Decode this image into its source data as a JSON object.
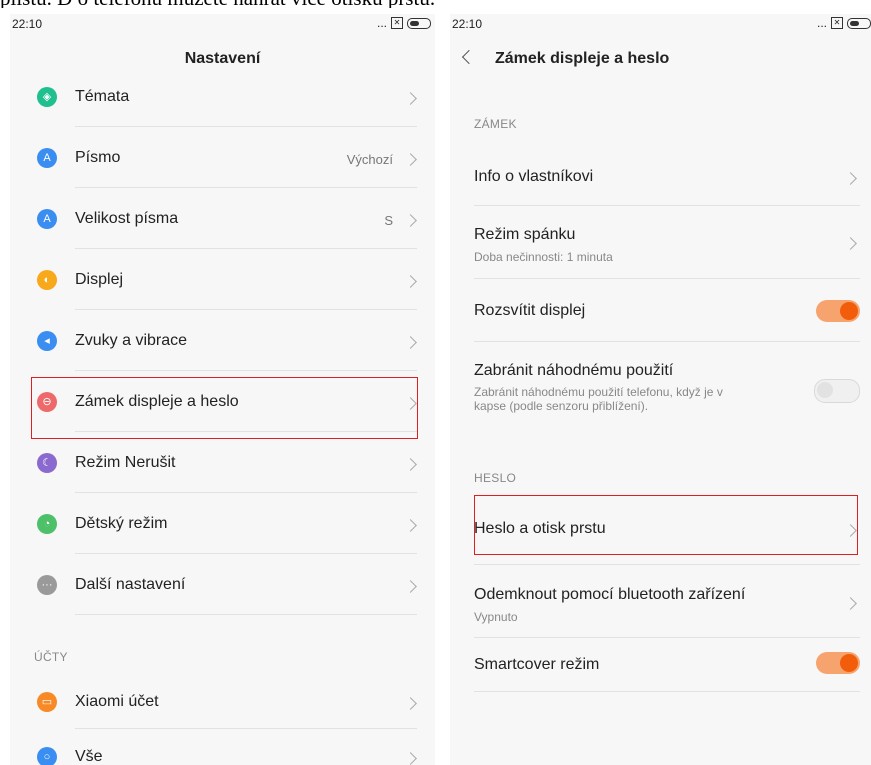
{
  "caption": "plíštu. D o telefonu mužete nahrát více otisku prstu.",
  "left_screen": {
    "status": {
      "time": "22:10",
      "icons": "..."
    },
    "title": "Nastavení",
    "items": [
      {
        "label": "Témata",
        "icon": "palette-icon",
        "color": "#1fbf8f",
        "glyph": "◈"
      },
      {
        "label": "Písmo",
        "icon": "font-icon",
        "color": "#3a8ef2",
        "glyph": "A",
        "value": "Výchozí"
      },
      {
        "label": "Velikost písma",
        "icon": "font-size-icon",
        "color": "#3a8ef2",
        "glyph": "A",
        "value": "S"
      },
      {
        "label": "Displej",
        "icon": "display-icon",
        "color": "#f7a81b",
        "glyph": "◐"
      },
      {
        "label": "Zvuky a vibrace",
        "icon": "sound-icon",
        "color": "#3a8ef2",
        "glyph": "◂"
      },
      {
        "label": "Zámek displeje a heslo",
        "icon": "lock-icon",
        "color": "#ee6a6a",
        "glyph": "⊖"
      },
      {
        "label": "Režim Nerušit",
        "icon": "moon-icon",
        "color": "#8b6acf",
        "glyph": "☾"
      },
      {
        "label": "Dětský režim",
        "icon": "child-mode-icon",
        "color": "#4fc06a",
        "glyph": "◔"
      },
      {
        "label": "Další nastavení",
        "icon": "more-icon",
        "color": "#9a9a9a",
        "glyph": "···"
      }
    ],
    "section_accounts": "ÚČTY",
    "account_items": [
      {
        "label": "Xiaomi účet",
        "icon": "mi-account-icon",
        "color": "#f78a26",
        "glyph": "▭"
      },
      {
        "label": "Vše",
        "icon": "user-icon",
        "color": "#3a8ef2",
        "glyph": "○"
      }
    ]
  },
  "right_screen": {
    "status": {
      "time": "22:10",
      "icons": "..."
    },
    "title": "Zámek displeje a heslo",
    "section_lock": "ZÁMEK",
    "owner_info": "Info o vlastníkovi",
    "sleep_mode": "Režim spánku",
    "sleep_sub": "Doba nečinnosti: 1 minuta",
    "wake_display": "Rozsvítit displej",
    "prevent_accidental": "Zabránit náhodnému použití",
    "prevent_sub_1": "Zabránit náhodnému použití telefonu, když je v",
    "prevent_sub_2": "kapse (podle senzoru přiblížení).",
    "section_password": "HESLO",
    "password_fingerprint": "Heslo a otisk prstu",
    "bluetooth_unlock": "Odemknout pomocí bluetooth zařízení",
    "bluetooth_sub": "Vypnuto",
    "smartcover": "Smartcover režim"
  },
  "colors": {
    "accent": "#f25d0b",
    "highlight": "#e02020"
  }
}
